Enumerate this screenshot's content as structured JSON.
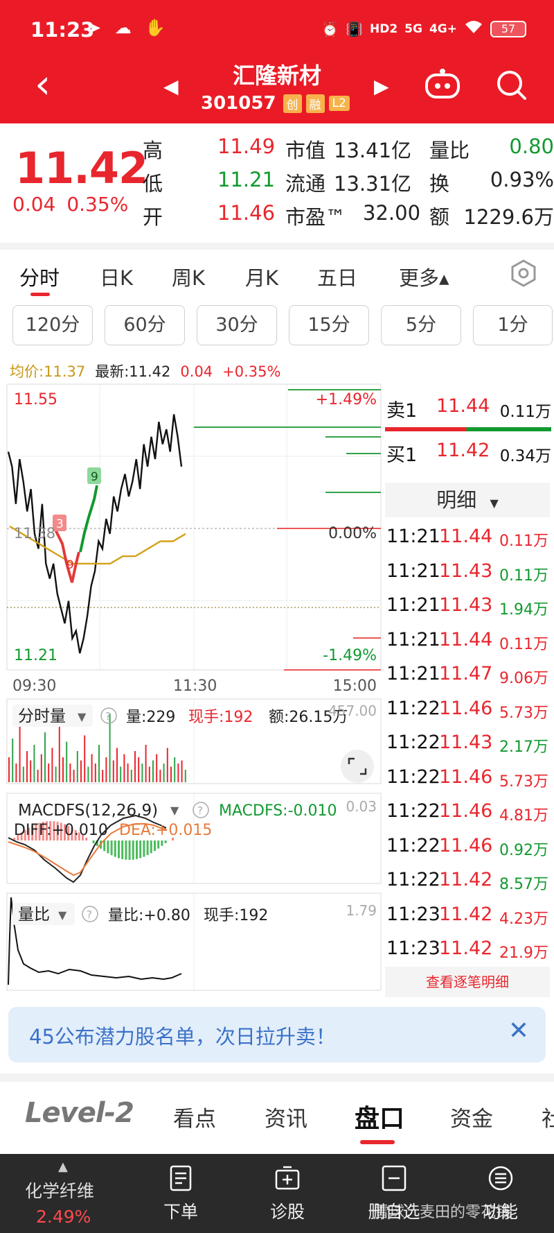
{
  "status_bar": {
    "time": "11:23",
    "left_icons": "➤ ☁ ✋",
    "right_icons": [
      "⏰",
      "📳",
      "HD2",
      "5G",
      "4G+",
      "WiFi"
    ],
    "battery": "57"
  },
  "header": {
    "back_icon": "‹",
    "prev_icon": "◀",
    "next_icon": "▶",
    "stock_name": "汇隆新材",
    "code": "301057",
    "tags": [
      "创",
      "融",
      "L2"
    ]
  },
  "quote": {
    "price": "11.42",
    "change": "0.04",
    "change_pct": "0.35%",
    "rows": [
      [
        {
          "l": "高",
          "v": "11.49",
          "vc": "red"
        },
        {
          "l": "市值",
          "v": "13.41亿"
        },
        {
          "l": "量比",
          "v": "0.80",
          "vc": "green"
        }
      ],
      [
        {
          "l": "低",
          "v": "11.21",
          "vc": "green"
        },
        {
          "l": "流通",
          "v": "13.31亿"
        },
        {
          "l": "换",
          "v": "0.93%"
        }
      ],
      [
        {
          "l": "开",
          "v": "11.46",
          "vc": "red"
        },
        {
          "l": "市盈™",
          "v": "32.00"
        },
        {
          "l": "额",
          "v": "1229.6万"
        }
      ]
    ]
  },
  "chart_tabs": [
    "分时",
    "日K",
    "周K",
    "月K",
    "五日",
    "更多▴"
  ],
  "periods": [
    "120分",
    "60分",
    "30分",
    "15分",
    "5分",
    "1分"
  ],
  "info": {
    "avg": "均价:11.37",
    "latest": "最新:11.42",
    "change": "0.04",
    "pct": "+0.35%"
  },
  "chart_data": {
    "type": "line",
    "ylim": [
      11.21,
      11.55
    ],
    "price_labels": {
      "high": "11.55",
      "low": "11.21",
      "mid": "11.38",
      "pct_high": "+1.49%",
      "pct_mid": "0.00%",
      "pct_low": "-1.49%"
    },
    "xticks": [
      "09:30",
      "11:30",
      "15:00"
    ],
    "markers": [
      "9",
      "3",
      "9"
    ],
    "series": [
      {
        "values": [
          11.48,
          11.46,
          11.41,
          11.47,
          11.44,
          11.4,
          11.43,
          11.37,
          11.35,
          11.41,
          11.33,
          11.31,
          11.33,
          11.29,
          11.27,
          11.25,
          11.28,
          11.23,
          11.24,
          11.21,
          11.23,
          11.26,
          11.3,
          11.32,
          11.36,
          11.35,
          11.39,
          11.37,
          11.42,
          11.4,
          11.43,
          11.45,
          11.42,
          11.44,
          11.47,
          11.43,
          11.49,
          11.46,
          11.5,
          11.47,
          11.52,
          11.49,
          11.51,
          11.48,
          11.53,
          11.5,
          11.46
        ]
      },
      {
        "values": [
          11.38,
          11.37,
          11.36,
          11.35,
          11.34,
          11.33,
          11.33,
          11.33,
          11.33,
          11.34,
          11.34,
          11.35,
          11.36,
          11.36,
          11.37
        ]
      }
    ],
    "volume_label": "分时量",
    "volume_stats": {
      "vol": "量:229",
      "hand": "现手:192",
      "amount": "额:26.15万",
      "max": "457.00"
    },
    "macd_label": "MACDFS(12,26,9)",
    "macd_stats": {
      "macdfs": "MACDFS:-0.010",
      "diff": "DIFF:+0.010",
      "dea": "DEA:+0.015",
      "max": "0.03"
    },
    "ratio_label": "量比",
    "ratio_stats": {
      "ratio": "量比:+0.80",
      "hand": "现手:192",
      "max": "1.79"
    }
  },
  "order_book": {
    "sell1": {
      "label": "卖1",
      "price": "11.44",
      "vol": "0.11万"
    },
    "buy1": {
      "label": "买1",
      "price": "11.42",
      "vol": "0.34万"
    },
    "detail_title": "明细",
    "more": "查看逐笔明细",
    "ticks": [
      {
        "t": "11:21",
        "p": "11.44",
        "v": "0.11万",
        "c": "red"
      },
      {
        "t": "11:21",
        "p": "11.43",
        "v": "0.11万",
        "c": "green"
      },
      {
        "t": "11:21",
        "p": "11.43",
        "v": "1.94万",
        "c": "green"
      },
      {
        "t": "11:21",
        "p": "11.44",
        "v": "0.11万",
        "c": "red"
      },
      {
        "t": "11:21",
        "p": "11.47",
        "v": "9.06万",
        "c": "red"
      },
      {
        "t": "11:22",
        "p": "11.46",
        "v": "5.73万",
        "c": "red"
      },
      {
        "t": "11:22",
        "p": "11.43",
        "v": "2.17万",
        "c": "green"
      },
      {
        "t": "11:22",
        "p": "11.46",
        "v": "5.73万",
        "c": "red"
      },
      {
        "t": "11:22",
        "p": "11.46",
        "v": "4.81万",
        "c": "red"
      },
      {
        "t": "11:22",
        "p": "11.46",
        "v": "0.92万",
        "c": "green"
      },
      {
        "t": "11:22",
        "p": "11.42",
        "v": "8.57万",
        "c": "green"
      },
      {
        "t": "11:23",
        "p": "11.42",
        "v": "4.23万",
        "c": "red"
      },
      {
        "t": "11:23",
        "p": "11.42",
        "v": "21.9万",
        "c": "red"
      }
    ]
  },
  "banner": {
    "text": "45公布潜力股名单，次日拉升卖！",
    "close": "✕"
  },
  "bottom_tabs": [
    "Level-2",
    "看点",
    "资讯",
    "盘口",
    "资金",
    "社"
  ],
  "bottom_bar": {
    "sector": "化学纤维",
    "sector_pct": "2.49%",
    "up_icon": "▲",
    "items": [
      "下单",
      "诊股",
      "删自选",
      "功能"
    ],
    "watermark": "雪球：麦田的零花钱"
  },
  "colors": {
    "brand_red": "#ea1b26",
    "up": "#e8262d",
    "down": "#12992f",
    "avg_line": "#d4a017"
  }
}
